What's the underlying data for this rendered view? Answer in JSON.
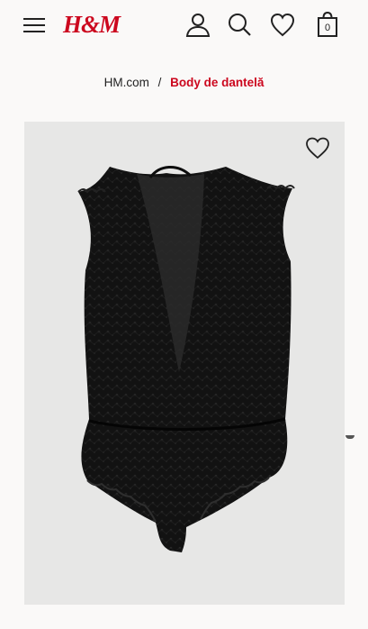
{
  "header": {
    "logo_text": "H&M",
    "bag_count": "0",
    "brand_color": "#cc071e",
    "icons": [
      "menu-icon",
      "account-icon",
      "search-icon",
      "heart-icon",
      "shopping-bag-icon"
    ]
  },
  "breadcrumb": {
    "home": "HM.com",
    "separator": "/",
    "current": "Body de dantelă"
  },
  "product": {
    "image_subject": "black lace bodysuit",
    "favorite_icon": "heart-outline-icon"
  }
}
